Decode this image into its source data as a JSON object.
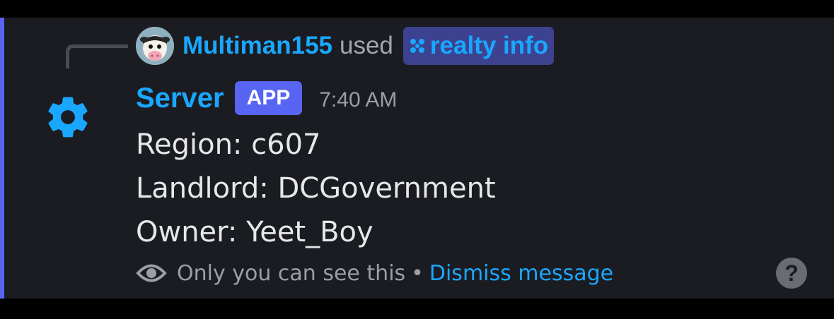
{
  "reply": {
    "username": "Multiman155",
    "used_text": "used",
    "command_name": "realty info"
  },
  "message": {
    "author": "Server",
    "badge": "APP",
    "timestamp": "7:40 AM",
    "lines": [
      "Region: c607",
      "Landlord: DCGovernment",
      "Owner: Yeet_Boy"
    ]
  },
  "footer": {
    "ephemeral_text": "Only you can see this",
    "separator": "•",
    "dismiss_label": "Dismiss message",
    "help_symbol": "?"
  },
  "icons": {
    "author_avatar": "gear-icon",
    "reply_avatar": "cow-avatar",
    "command": "app-command-icon",
    "ephemeral": "eye-icon",
    "help": "help-icon"
  },
  "colors": {
    "background": "#1b1c21",
    "accent_bar": "#5865f2",
    "link_blue": "#1aa7ff",
    "command_pill": "#3c4290",
    "app_badge": "#5865f2",
    "muted_text": "#9b9ea6",
    "body_text": "#e6e7ea"
  }
}
